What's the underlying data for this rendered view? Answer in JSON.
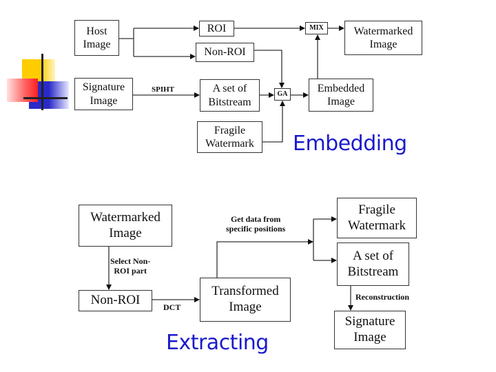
{
  "accent_color": "#1a1acc",
  "embedding": {
    "title": "Embedding",
    "nodes": {
      "host_image": "Host\nImage",
      "roi": "ROI",
      "non_roi": "Non-ROI",
      "mix": "MIX",
      "watermarked_image": "Watermarked\nImage",
      "signature_image": "Signature\nImage",
      "bitstream": "A set of\nBitstream",
      "ga": "GA",
      "embedded_image": "Embedded\nImage",
      "fragile_watermark": "Fragile\nWatermark"
    },
    "edge_labels": {
      "spiht": "SPIHT"
    }
  },
  "extracting": {
    "title": "Extracting",
    "nodes": {
      "watermarked_image": "Watermarked\nImage",
      "non_roi": "Non-ROI",
      "transformed_image": "Transformed\nImage",
      "fragile_watermark": "Fragile\nWatermark",
      "bitstream": "A set of\nBitstream",
      "signature_image": "Signature\nImage"
    },
    "edge_labels": {
      "select_non_roi": "Select Non-\nROI part",
      "dct": "DCT",
      "get_data": "Get data from\nspecific positions",
      "reconstruction": "Reconstruction"
    }
  }
}
